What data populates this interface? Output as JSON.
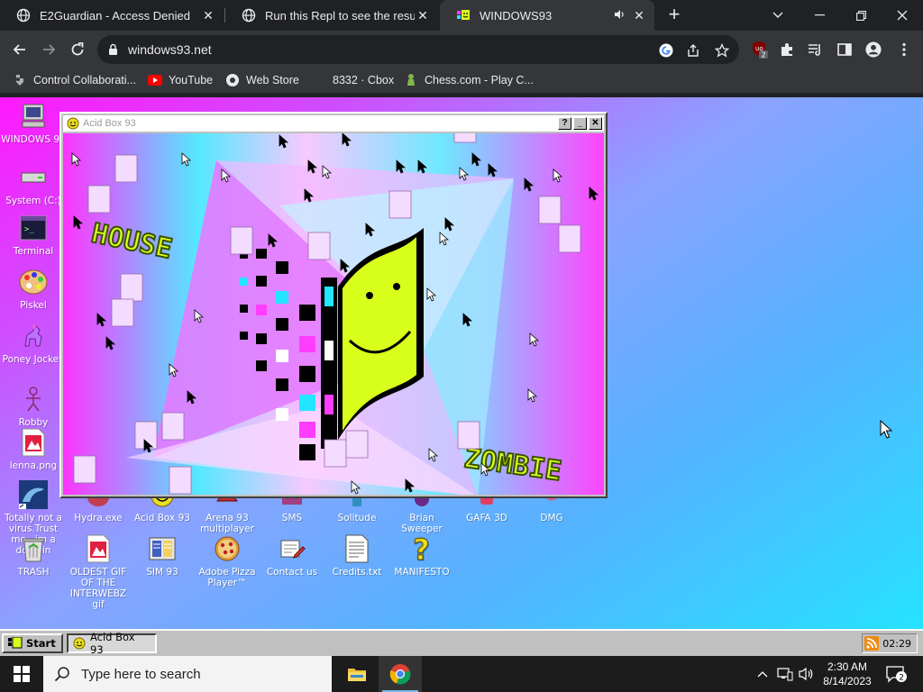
{
  "browser": {
    "tabs": [
      {
        "title": "E2Guardian - Access Denied",
        "icon": "globe-icon"
      },
      {
        "title": "Run this Repl to see the results h",
        "icon": "globe-icon"
      },
      {
        "title": "WINDOWS93",
        "icon": "windows93-icon",
        "active": true
      }
    ],
    "new_tab": "+",
    "url": "windows93.net",
    "extension_badge": "2",
    "bookmarks": [
      {
        "label": "Control Collaborati...",
        "icon": "puzzle-icon"
      },
      {
        "label": "YouTube",
        "icon": "youtube-icon"
      },
      {
        "label": "Web Store",
        "icon": "webstore-icon"
      },
      {
        "label": "8332 · Cbox",
        "icon": "blank-icon"
      },
      {
        "label": "Chess.com - Play C...",
        "icon": "pawn-icon"
      }
    ]
  },
  "desktop": {
    "left_icons": [
      {
        "label": "WINDOWS 93",
        "icon": "computer-icon"
      },
      {
        "label": "System (C:)",
        "icon": "drive-icon"
      },
      {
        "label": "Terminal",
        "icon": "terminal-icon"
      },
      {
        "label": "Piskel",
        "icon": "palette-icon"
      },
      {
        "label": "Poney Jockey",
        "icon": "pony-icon"
      },
      {
        "label": "Robby",
        "icon": "stickman-icon"
      },
      {
        "label": "lenna.png",
        "icon": "image-file-icon"
      },
      {
        "label": "Totally not a virus.Trust me...im a dolphin",
        "icon": "dolphin-icon"
      },
      {
        "label": "TRASH",
        "icon": "trash-icon"
      }
    ],
    "row1_icons": [
      {
        "label": "Hydra.exe",
        "icon": "hydra-icon"
      },
      {
        "label": "Acid Box 93",
        "icon": "acidbox-icon"
      },
      {
        "label": "Arena 93 multiplayer",
        "icon": "arena-icon"
      },
      {
        "label": "SMS",
        "icon": "sms-icon"
      },
      {
        "label": "Solitude",
        "icon": "solitude-icon"
      },
      {
        "label": "Brian Sweeper",
        "icon": "sweeper-icon"
      },
      {
        "label": "GAFA 3D",
        "icon": "gafa-icon"
      },
      {
        "label": "DMG",
        "icon": "dmg-icon"
      }
    ],
    "row2_icons": [
      {
        "label": "OLDEST GIF OF THE INTERWEBZ gif",
        "icon": "gif-file-icon"
      },
      {
        "label": "SIM 93",
        "icon": "sim-icon"
      },
      {
        "label": "Adobe Pizza Player™",
        "icon": "pizza-icon"
      },
      {
        "label": "Contact us",
        "icon": "contact-icon"
      },
      {
        "label": "Credits.txt",
        "icon": "text-file-icon"
      },
      {
        "label": "MANIFESTO",
        "icon": "question-icon"
      }
    ]
  },
  "acid_window": {
    "title": "Acid Box 93",
    "help": "?",
    "minimize": "_",
    "close": "✕",
    "art_words": [
      "HOUSE",
      "ZOMBIE"
    ]
  },
  "w93_taskbar": {
    "start": "Start",
    "task": "Acid Box 93",
    "clock": "02:29"
  },
  "windows_taskbar": {
    "search_placeholder": "Type here to search",
    "time": "2:30 AM",
    "date": "8/14/2023",
    "notifications": "2"
  },
  "colors": {
    "chrome_dark": "#202124",
    "chrome_toolbar": "#35363a",
    "desktop_pink": "#ff19ff",
    "desktop_cyan": "#22e6ff",
    "w93_gray": "#c0c0c0",
    "smiley_yellow": "#d8ff1c"
  }
}
